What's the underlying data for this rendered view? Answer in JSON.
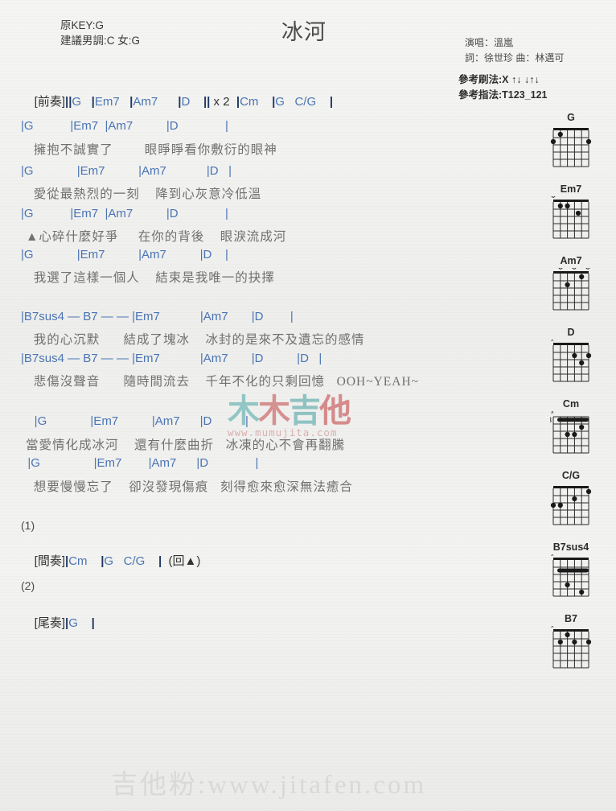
{
  "header": {
    "original_key": "原KEY:G",
    "suggested_key": "建議男調:C 女:G",
    "title": "冰河",
    "singer": "演唱：溫嵐",
    "writers": "詞：徐世珍  曲：林邁可",
    "strum_label": "參考刷法:X",
    "strum_pattern": "↑↓ ↓↑↓",
    "fingerstyle_label": "參考指法:",
    "fingerstyle_pattern": "T123_121"
  },
  "sheet": {
    "intro": {
      "tag": "[前奏]",
      "chords": "||G   |Em7   |Am7      |D    || x 2  |Cm    |G   C/G    |"
    },
    "verses": [
      {
        "chords": "|G           |Em7  |Am7          |D              |",
        "lyric": "  擁抱不誠實了        眼睜睜看你敷衍的眼神"
      },
      {
        "chords": "|G             |Em7          |Am7            |D   |",
        "lyric": "  愛從最熱烈的一刻    降到心灰意冷低溫"
      },
      {
        "chords": "|G           |Em7  |Am7          |D              |",
        "lyric": "▲心碎什麼好爭     在你的背後    眼淚流成河"
      },
      {
        "chords": "|G             |Em7          |Am7          |D    |",
        "lyric": "  我選了這樣一個人    結束是我唯一的抉擇"
      }
    ],
    "chorus": [
      {
        "chords": "|B7sus4 — B7 — — |Em7            |Am7       |D        |",
        "lyric": "  我的心沉默      結成了塊冰    冰封的是來不及遺忘的感情"
      },
      {
        "chords": "|B7sus4 — B7 — — |Em7            |Am7       |D          |D   |",
        "lyric": "  悲傷沒聲音      隨時間流去    千年不化的只剩回憶   OOH~YEAH~"
      },
      {
        "chords": "    |G             |Em7          |Am7      |D          |",
        "lyric": "當愛情化成冰河    還有什麼曲折   冰凍的心不會再翻騰"
      },
      {
        "chords": "  |G                |Em7        |Am7      |D              |",
        "lyric": "  想要慢慢忘了    卻沒發現傷痕   刻得愈來愈深無法癒合"
      }
    ],
    "endings": [
      {
        "number": "(1)",
        "tag": "[間奏]",
        "chords": "|Cm    |G   C/G    |  (回▲)"
      },
      {
        "number": "(2)",
        "tag": "[尾奏]",
        "chords": "|G    |"
      }
    ]
  },
  "diagrams": [
    {
      "name": "G",
      "open_marks": "",
      "base_fret": "",
      "dots": "6th/3rd/1st strings"
    },
    {
      "name": "Em7",
      "open_marks": "o",
      "base_fret": "",
      "dots": "5th,4th,2nd strings"
    },
    {
      "name": "Am7",
      "open_marks": "o o o",
      "base_fret": "",
      "dots": "4th,2nd strings"
    },
    {
      "name": "D",
      "open_marks": "x",
      "base_fret": "",
      "dots": "3rd,1st,2nd strings"
    },
    {
      "name": "Cm",
      "open_marks": "x",
      "base_fret": "3",
      "dots": "barre + 4th,3rd,2nd"
    },
    {
      "name": "C/G",
      "open_marks": "",
      "base_fret": "",
      "dots": "1st,3rd,5th,4th"
    },
    {
      "name": "B7sus4",
      "open_marks": "x",
      "base_fret": "",
      "dots": "barre + 3rd,1st"
    },
    {
      "name": "B7",
      "open_marks": "x",
      "base_fret": "",
      "dots": "4th,5th,3rd,1st"
    }
  ],
  "watermarks": {
    "middle_text_1": "木",
    "middle_text_2": "木",
    "middle_text_3": "吉",
    "middle_text_4": "他",
    "middle_url": "www.mumujita.com",
    "bottom": "吉他粉:www.jitafen.com"
  }
}
